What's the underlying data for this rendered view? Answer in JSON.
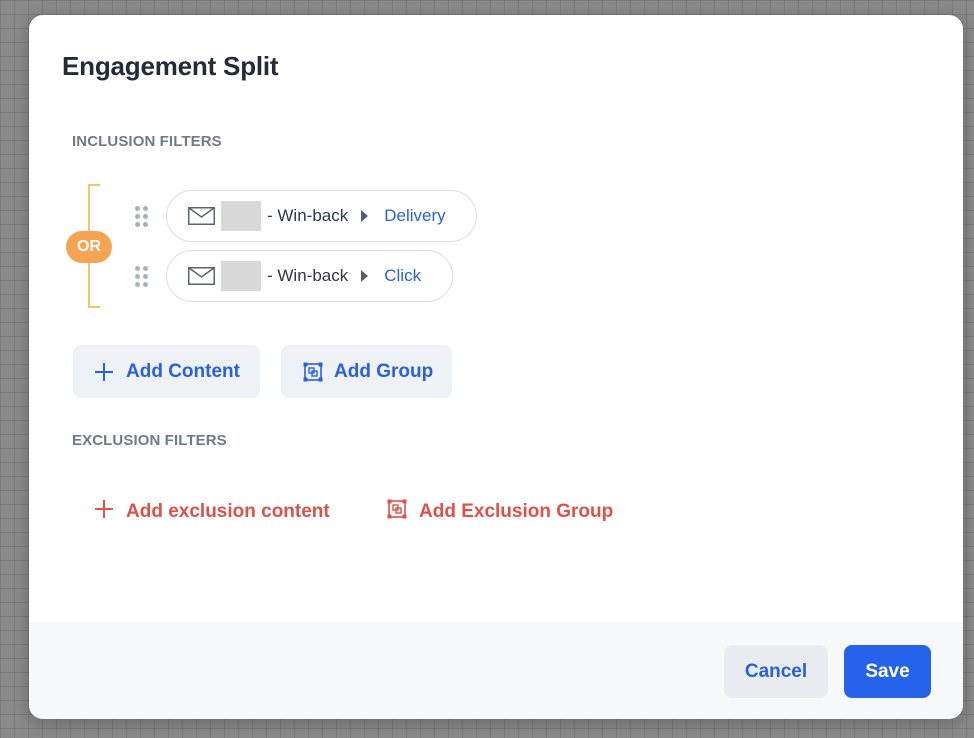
{
  "modal": {
    "title": "Engagement Split"
  },
  "inclusion": {
    "label": "INCLUSION FILTERS",
    "operator": "OR",
    "filters": [
      {
        "icon": "envelope-icon",
        "name": "- Win-back",
        "event": "Delivery"
      },
      {
        "icon": "envelope-icon",
        "name": "- Win-back",
        "event": "Click"
      }
    ],
    "add_content_label": "Add Content",
    "add_group_label": "Add Group"
  },
  "exclusion": {
    "label": "EXCLUSION FILTERS",
    "add_content_label": "Add exclusion content",
    "add_group_label": "Add Exclusion Group"
  },
  "footer": {
    "cancel_label": "Cancel",
    "save_label": "Save"
  },
  "colors": {
    "accent_blue": "#2563eb",
    "link_blue": "#2a61d6",
    "exclusion_red": "#de5149",
    "or_orange": "#f5a552",
    "bracket_yellow": "#f2c46b"
  }
}
